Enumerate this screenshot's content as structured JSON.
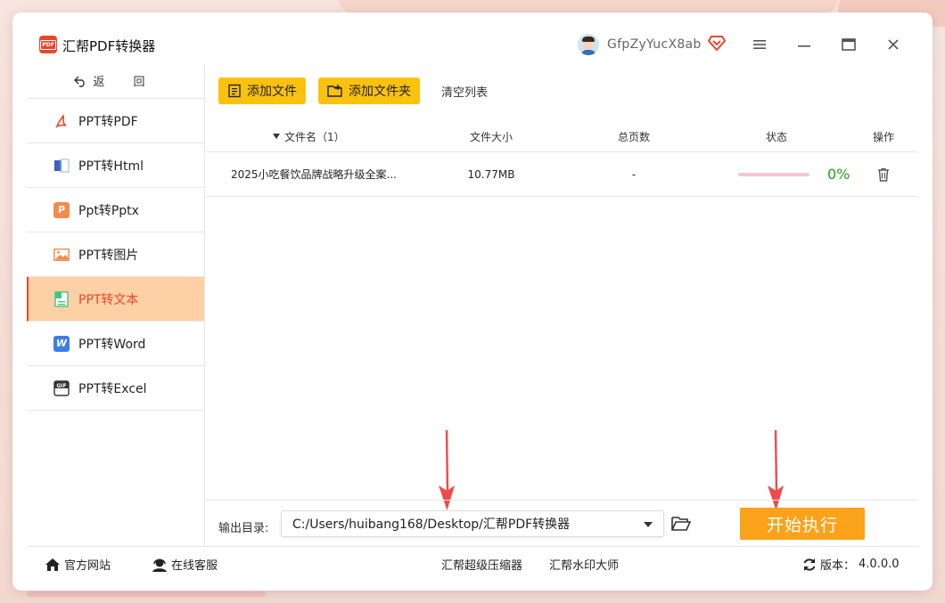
{
  "app": {
    "title": "汇帮PDF转换器",
    "logo_text": "PDF"
  },
  "user": {
    "name": "GfpZyYucX8ab"
  },
  "window_controls": {
    "menu": "menu-icon",
    "minimize": "minimize-icon",
    "maximize": "maximize-icon",
    "close": "close-icon"
  },
  "sidebar": {
    "back_label": "返 回",
    "items": [
      {
        "label": "PPT转PDF",
        "icon": "pdf-icon",
        "color": "#e9472a",
        "active": false
      },
      {
        "label": "PPT转Html",
        "icon": "html-icon",
        "color": "#3b5fc4",
        "active": false
      },
      {
        "label": "Ppt转Pptx",
        "icon": "pptx-icon",
        "color": "#f58a4d",
        "active": false
      },
      {
        "label": "PPT转图片",
        "icon": "image-icon",
        "color": "#f58a4d",
        "active": false
      },
      {
        "label": "PPT转文本",
        "icon": "text-icon",
        "color": "#3fc77d",
        "active": true
      },
      {
        "label": "PPT转Word",
        "icon": "word-icon",
        "color": "#3b7ee8",
        "active": false
      },
      {
        "label": "PPT转Excel",
        "icon": "gif-icon",
        "color": "#333333",
        "active": false
      }
    ]
  },
  "toolbar": {
    "add_file": "添加文件",
    "add_folder": "添加文件夹",
    "clear_list": "清空列表"
  },
  "table": {
    "headers": {
      "name": "文件名（1）",
      "size": "文件大小",
      "pages": "总页数",
      "status": "状态",
      "ops": "操作"
    },
    "rows": [
      {
        "name": "2025小吃餐饮品牌战略升级全案...",
        "size": "10.77MB",
        "pages": "-",
        "progress": 0,
        "percent": "0%"
      }
    ]
  },
  "output": {
    "label": "输出目录:",
    "path": "C:/Users/huibang168/Desktop/汇帮PDF转换器",
    "start_label": "开始执行"
  },
  "footer": {
    "site": "官方网站",
    "support": "在线客服",
    "compress": "汇帮超级压缩器",
    "watermark": "汇帮水印大师",
    "version_label": "版本：",
    "version": "4.0.0.0"
  },
  "colors": {
    "accent": "#e9472a",
    "button_yellow": "#f9c20e",
    "start_orange": "#fba21b",
    "active_bg": "#fdd0a6",
    "success_green": "#1ba21b"
  }
}
